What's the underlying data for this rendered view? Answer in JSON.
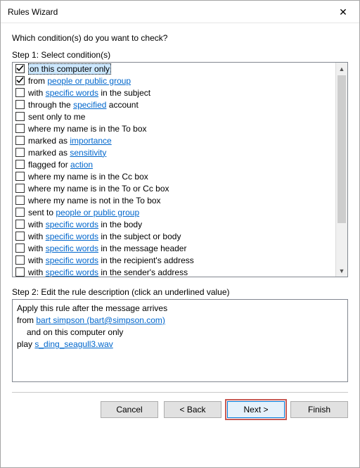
{
  "window": {
    "title": "Rules Wizard",
    "close_glyph": "✕"
  },
  "prompt": "Which condition(s) do you want to check?",
  "step1_label": "Step 1: Select condition(s)",
  "conditions": [
    {
      "checked": true,
      "selected": true,
      "parts": [
        {
          "t": "on this computer only"
        }
      ]
    },
    {
      "checked": true,
      "selected": false,
      "parts": [
        {
          "t": "from "
        },
        {
          "t": "people or public group",
          "link": true
        }
      ]
    },
    {
      "checked": false,
      "selected": false,
      "parts": [
        {
          "t": "with "
        },
        {
          "t": "specific words",
          "link": true
        },
        {
          "t": " in the subject"
        }
      ]
    },
    {
      "checked": false,
      "selected": false,
      "parts": [
        {
          "t": "through the "
        },
        {
          "t": "specified",
          "link": true
        },
        {
          "t": " account"
        }
      ]
    },
    {
      "checked": false,
      "selected": false,
      "parts": [
        {
          "t": "sent only to me"
        }
      ]
    },
    {
      "checked": false,
      "selected": false,
      "parts": [
        {
          "t": "where my name is in the To box"
        }
      ]
    },
    {
      "checked": false,
      "selected": false,
      "parts": [
        {
          "t": "marked as "
        },
        {
          "t": "importance",
          "link": true
        }
      ]
    },
    {
      "checked": false,
      "selected": false,
      "parts": [
        {
          "t": "marked as "
        },
        {
          "t": "sensitivity",
          "link": true
        }
      ]
    },
    {
      "checked": false,
      "selected": false,
      "parts": [
        {
          "t": "flagged for "
        },
        {
          "t": "action",
          "link": true
        }
      ]
    },
    {
      "checked": false,
      "selected": false,
      "parts": [
        {
          "t": "where my name is in the Cc box"
        }
      ]
    },
    {
      "checked": false,
      "selected": false,
      "parts": [
        {
          "t": "where my name is in the To or Cc box"
        }
      ]
    },
    {
      "checked": false,
      "selected": false,
      "parts": [
        {
          "t": "where my name is not in the To box"
        }
      ]
    },
    {
      "checked": false,
      "selected": false,
      "parts": [
        {
          "t": "sent to "
        },
        {
          "t": "people or public group",
          "link": true
        }
      ]
    },
    {
      "checked": false,
      "selected": false,
      "parts": [
        {
          "t": "with "
        },
        {
          "t": "specific words",
          "link": true
        },
        {
          "t": " in the body"
        }
      ]
    },
    {
      "checked": false,
      "selected": false,
      "parts": [
        {
          "t": "with "
        },
        {
          "t": "specific words",
          "link": true
        },
        {
          "t": " in the subject or body"
        }
      ]
    },
    {
      "checked": false,
      "selected": false,
      "parts": [
        {
          "t": "with "
        },
        {
          "t": "specific words",
          "link": true
        },
        {
          "t": " in the message header"
        }
      ]
    },
    {
      "checked": false,
      "selected": false,
      "parts": [
        {
          "t": "with "
        },
        {
          "t": "specific words",
          "link": true
        },
        {
          "t": " in the recipient's address"
        }
      ]
    },
    {
      "checked": false,
      "selected": false,
      "parts": [
        {
          "t": "with "
        },
        {
          "t": "specific words",
          "link": true
        },
        {
          "t": " in the sender's address"
        }
      ]
    }
  ],
  "step2_label": "Step 2: Edit the rule description (click an underlined value)",
  "description": {
    "line1": "Apply this rule after the message arrives",
    "line2_prefix": "from ",
    "line2_link": "bart simpson (bart@simpson.com)",
    "line3": "and on this computer only",
    "line4_prefix": "play ",
    "line4_link": "s_ding_seagull3.wav"
  },
  "buttons": {
    "cancel": "Cancel",
    "back": "< Back",
    "next": "Next >",
    "finish": "Finish"
  },
  "scroll": {
    "up_glyph": "▲",
    "down_glyph": "▼"
  }
}
